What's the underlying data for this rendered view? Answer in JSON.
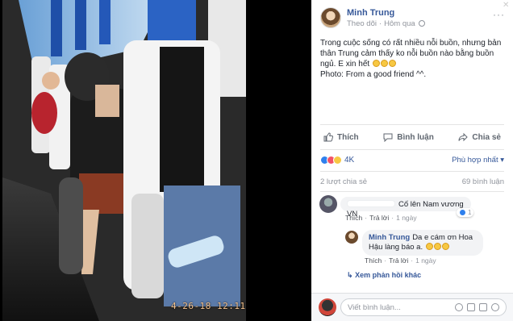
{
  "photo": {
    "timestamp": "4-26-18 12:11"
  },
  "post": {
    "author": "Minh Trung",
    "follow_label": "Theo dõi",
    "time": "Hôm qua",
    "text_line1": "Trong cuộc sống có rất nhiều nỗi buồn, nhưng bản thân Trung cảm thấy ko nỗi buồn nào bằng buồn ngủ. E xin hết",
    "text_line2": "Photo: From a good friend ^^.",
    "actions": {
      "like": "Thích",
      "comment": "Bình luận",
      "share": "Chia sẻ"
    },
    "reaction_count": "4K",
    "sort_label": "Phù hợp nhất",
    "shares": "2 lượt chia sẻ",
    "comments_count": "69 bình luận"
  },
  "comments": [
    {
      "text": "Cố lên Nam vương VN",
      "like_label": "Thích",
      "reply_label": "Trả lời",
      "time": "1 ngày",
      "likes": "1"
    },
    {
      "name": "Minh Trung",
      "text": "Da e cám ơn Hoa Hậu làng báo a.",
      "like_label": "Thích",
      "reply_label": "Trả lời",
      "time": "1 ngày"
    }
  ],
  "more_replies": "Xem phản hồi khác",
  "compose": {
    "placeholder": "Viết bình luận..."
  },
  "colors": {
    "link": "#365899",
    "muted": "#90949c",
    "text": "#1d2129",
    "bubble": "#f2f3f5"
  }
}
